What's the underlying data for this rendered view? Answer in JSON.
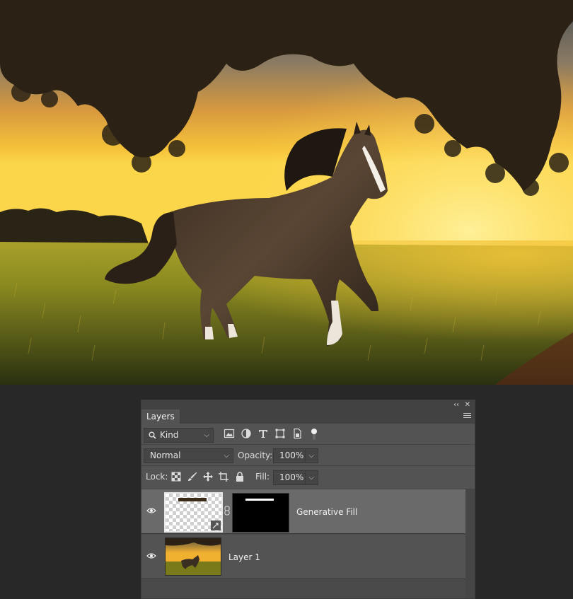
{
  "panel": {
    "tab_label": "Layers",
    "filter": {
      "kind_label": "Kind"
    },
    "blend_mode": "Normal",
    "opacity_label": "Opacity:",
    "opacity_value": "100%",
    "lock_label": "Lock:",
    "fill_label": "Fill:",
    "fill_value": "100%"
  },
  "layers": [
    {
      "name": "Generative Fill",
      "selected": true,
      "visible": true,
      "has_mask": true
    },
    {
      "name": "Layer 1",
      "selected": false,
      "visible": true,
      "has_mask": false
    }
  ],
  "icons": {
    "collapse": "double-chevron-left-icon",
    "close": "close-icon",
    "panel_menu": "hamburger-menu-icon",
    "search": "search-icon",
    "eye": "eye-icon",
    "link": "chain-link-icon"
  },
  "colors": {
    "panel_bg": "#535353",
    "selected_layer_bg": "#6a6a6a",
    "workspace_bg": "#282828"
  }
}
